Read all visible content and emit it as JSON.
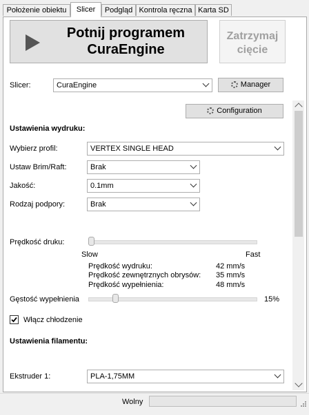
{
  "tabs": [
    {
      "label": "Położenie obiektu"
    },
    {
      "label": "Slicer"
    },
    {
      "label": "Podgląd"
    },
    {
      "label": "Kontrola ręczna"
    },
    {
      "label": "Karta SD"
    }
  ],
  "slice_button": {
    "line1": "Potnij programem",
    "line2": "CuraEngine"
  },
  "stop_button": {
    "line1": "Zatrzymaj",
    "line2": "cięcie"
  },
  "slicer": {
    "label": "Slicer:",
    "value": "CuraEngine",
    "manager_label": "Manager"
  },
  "configuration_label": "Configuration",
  "print_settings": {
    "title": "Ustawienia wydruku:",
    "profile_label": "Wybierz profil:",
    "profile_value": "VERTEX SINGLE HEAD",
    "brim_label": "Ustaw Brim/Raft:",
    "brim_value": "Brak",
    "quality_label": "Jakość:",
    "quality_value": "0.1mm",
    "support_label": "Rodzaj podpory:",
    "support_value": "Brak"
  },
  "speed": {
    "label": "Prędkość druku:",
    "slow": "Slow",
    "fast": "Fast",
    "level": 0,
    "print_speed_label": "Prędkość wydruku:",
    "print_speed_value": "42 mm/s",
    "outer_speed_label": "Prędkość zewnętrznych obrysów:",
    "outer_speed_value": "35 mm/s",
    "infill_speed_label": "Prędkość wypełnienia:",
    "infill_speed_value": "48 mm/s"
  },
  "infill": {
    "label": "Gęstość wypełnienia",
    "value": "15%",
    "percent": 15
  },
  "cooling": {
    "label": "Włącz chłodzenie",
    "checked": true
  },
  "filament": {
    "title": "Ustawienia filamentu:",
    "extruder_label": "Ekstruder 1:",
    "extruder_value": "PLA-1,75MM"
  },
  "status": {
    "text": "Wolny"
  }
}
